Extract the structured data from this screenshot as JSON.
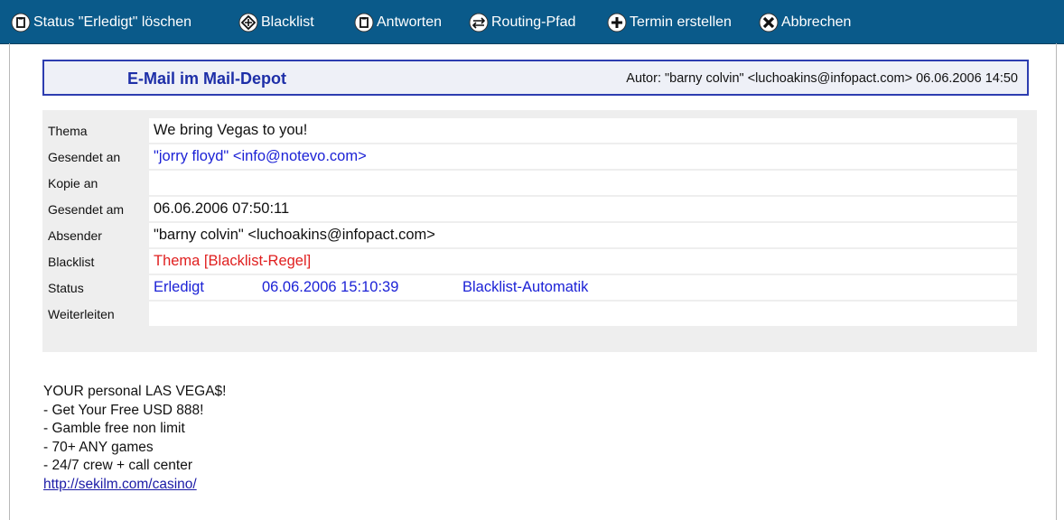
{
  "toolbar": {
    "buttons": [
      {
        "label": "Status \"Erledigt\" löschen",
        "icon": "clipboard-icon"
      },
      {
        "label": "Blacklist",
        "icon": "diamond-arrows-icon"
      },
      {
        "label": "Antworten",
        "icon": "reply-icon"
      },
      {
        "label": "Routing-Pfad",
        "icon": "routing-arrows-icon"
      },
      {
        "label": "Termin erstellen",
        "icon": "plus-icon"
      },
      {
        "label": "Abbrechen",
        "icon": "cancel-icon"
      }
    ]
  },
  "header": {
    "title": "E-Mail im Mail-Depot",
    "meta": "Autor: \"barny colvin\" <luchoakins@infopact.com> 06.06.2006 14:50"
  },
  "info": {
    "subject_label": "Thema",
    "subject": "We bring Vegas to you!",
    "to_label": "Gesendet an",
    "to": "\"jorry floyd\" <info@notevo.com>",
    "cc_label": "Kopie an",
    "cc": "",
    "sent_label": "Gesendet am",
    "sent": "06.06.2006 07:50:11",
    "sender_label": "Absender",
    "sender": "\"barny colvin\" <luchoakins@infopact.com>",
    "blacklist_label": "Blacklist",
    "blacklist": "Thema [Blacklist-Regel]",
    "status_label": "Status",
    "status": "Erledigt",
    "status_date": "06.06.2006 15:10:39",
    "status_by": "Blacklist-Automatik",
    "forward_label": "Weiterleiten",
    "forward": ""
  },
  "body": {
    "lines": [
      "YOUR personal LAS VEGA$!",
      "- Get Your Free USD 888!",
      "- Gamble free non limit",
      "- 70+ ANY games",
      "- 24/7 crew + call center"
    ],
    "link": "http://sekilm.com/casino/"
  },
  "colors": {
    "toolbar_bg": "#0a5a8a",
    "header_border": "#2d3db0",
    "title": "#1e2fa8",
    "link_blue": "#1c22d6",
    "alert_red": "#e02020"
  }
}
